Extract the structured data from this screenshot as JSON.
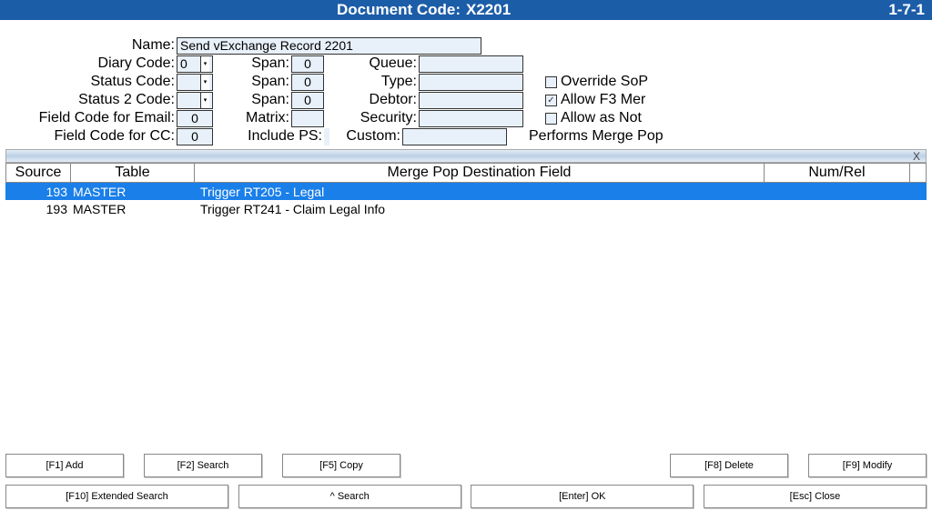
{
  "top": {
    "doc_code_label": "Document Code:",
    "doc_code": "X2201",
    "right": "1-7-1"
  },
  "form": {
    "name_label": "Name:",
    "name": "Send vExchange Record 2201",
    "diary_label": "Diary Code:",
    "diary_value": "0",
    "span_label": "Span:",
    "span1": "0",
    "span2": "0",
    "span3": "0",
    "queue_label": "Queue:",
    "queue": "",
    "status_label": "Status Code:",
    "type_label": "Type:",
    "type": "",
    "status2_label": "Status 2 Code:",
    "debtor_label": "Debtor:",
    "debtor": "",
    "fc_email_label": "Field Code for Email:",
    "fc_email": "0",
    "matrix_label": "Matrix:",
    "matrix": "",
    "security_label": "Security:",
    "security": "",
    "fc_cc_label": "Field Code for CC:",
    "fc_cc": "0",
    "include_ps_label": "Include PS:",
    "include_ps": "",
    "custom_label": "Custom:",
    "custom_text": "Performs Merge Pop",
    "chk1_label": "Override SoP",
    "chk2_label": "Allow F3 Mer",
    "chk3_label": "Allow as Not"
  },
  "sep": {
    "x": "X"
  },
  "table": {
    "headers": {
      "source": "Source",
      "table": "Table",
      "dest": "Merge Pop Destination Field",
      "num": "Num/Rel"
    },
    "rows": [
      {
        "source": "193",
        "table": "MASTER",
        "dest": "Trigger RT205 - Legal",
        "selected": true
      },
      {
        "source": "193",
        "table": "MASTER",
        "dest": "Trigger RT241 - Claim Legal Info",
        "selected": false
      }
    ]
  },
  "buttons": {
    "f1": "[F1] Add",
    "f2": "[F2] Search",
    "f5": "[F5] Copy",
    "f8": "[F8] Delete",
    "f9": "[F9] Modify",
    "f10": "[F10] Extended Search",
    "caret": "^ Search",
    "enter": "[Enter] OK",
    "esc": "[Esc] Close"
  }
}
